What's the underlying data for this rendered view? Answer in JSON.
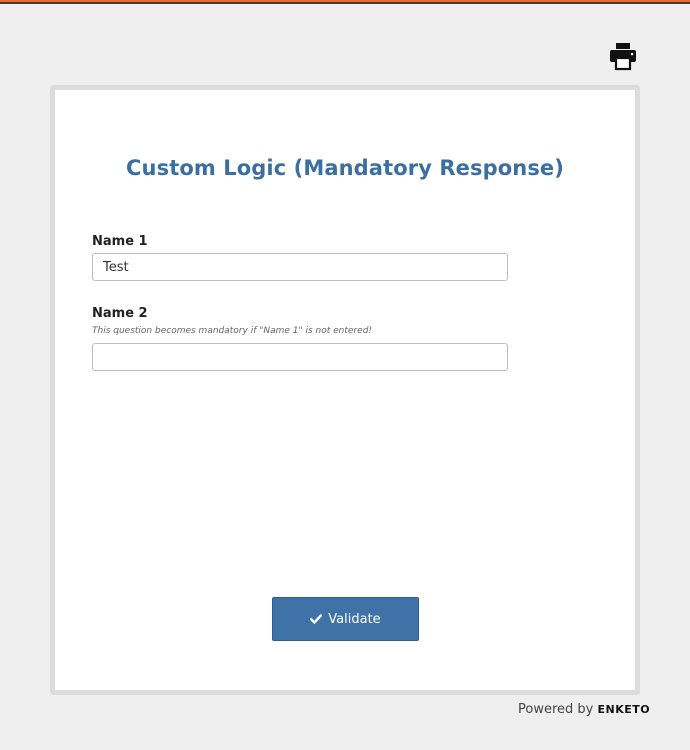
{
  "form": {
    "title": "Custom Logic (Mandatory Response)",
    "questions": [
      {
        "label": "Name 1",
        "hint": "",
        "value": "Test",
        "placeholder": ""
      },
      {
        "label": "Name 2",
        "hint": "This question becomes mandatory if \"Name 1\" is not entered!",
        "value": "",
        "placeholder": ""
      }
    ],
    "validate_label": "Validate",
    "validate_icon": "check-icon"
  },
  "toolbar": {
    "print_icon": "printer-icon"
  },
  "footer": {
    "powered_by": "Powered by",
    "brand": "ENKETO"
  },
  "colors": {
    "accent_bar": "#e8692b",
    "title": "#3b6ea1",
    "button": "#3f73a8",
    "background": "#efefef"
  }
}
